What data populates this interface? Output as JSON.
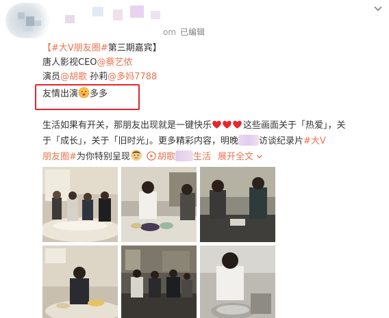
{
  "post": {
    "meta": {
      "time_suffix": "om",
      "edited": "已编辑"
    },
    "line1": {
      "tag": "【#大V朋友圈#",
      "tail": "第三期嘉宾】"
    },
    "line2": {
      "prefix": "唐人影视CEO",
      "mention": "@蔡艺侬"
    },
    "line3": {
      "prefix": "演员",
      "mention1": "@胡歌",
      "middle": " 孙莉",
      "mention2": "@多妈7788"
    },
    "line4": {
      "prefix": "友情出演",
      "suffix": "多多"
    },
    "para": {
      "part1": "生活如果有开关，那朋友出现就是一键快乐",
      "part2": "这些画面关于「热爱」，关",
      "part3": "于「成长」，关于「旧时光」。更多精彩内容，明晚",
      "part4": "访谈纪录片",
      "tag": "#大V",
      "tag2": "朋友圈#",
      "part5": "为你特别呈现",
      "video_link": "胡歌",
      "video_link_tail": "生活",
      "expand": "展开全文"
    }
  },
  "images": [
    {
      "name": "photo-1",
      "wm": ""
    },
    {
      "name": "photo-2",
      "wm": ""
    },
    {
      "name": "photo-3",
      "wm": ""
    },
    {
      "name": "photo-4",
      "wm": ""
    },
    {
      "name": "photo-5",
      "wm": ""
    },
    {
      "name": "photo-6",
      "wm": ""
    }
  ],
  "colors": {
    "link": "#eb7350",
    "text": "#333333",
    "meta": "#999999",
    "highlight_box": "#e3242b"
  },
  "icons": [
    "chevron-down-icon",
    "heart-icon",
    "face-emoji-icon",
    "video-link-icon"
  ]
}
